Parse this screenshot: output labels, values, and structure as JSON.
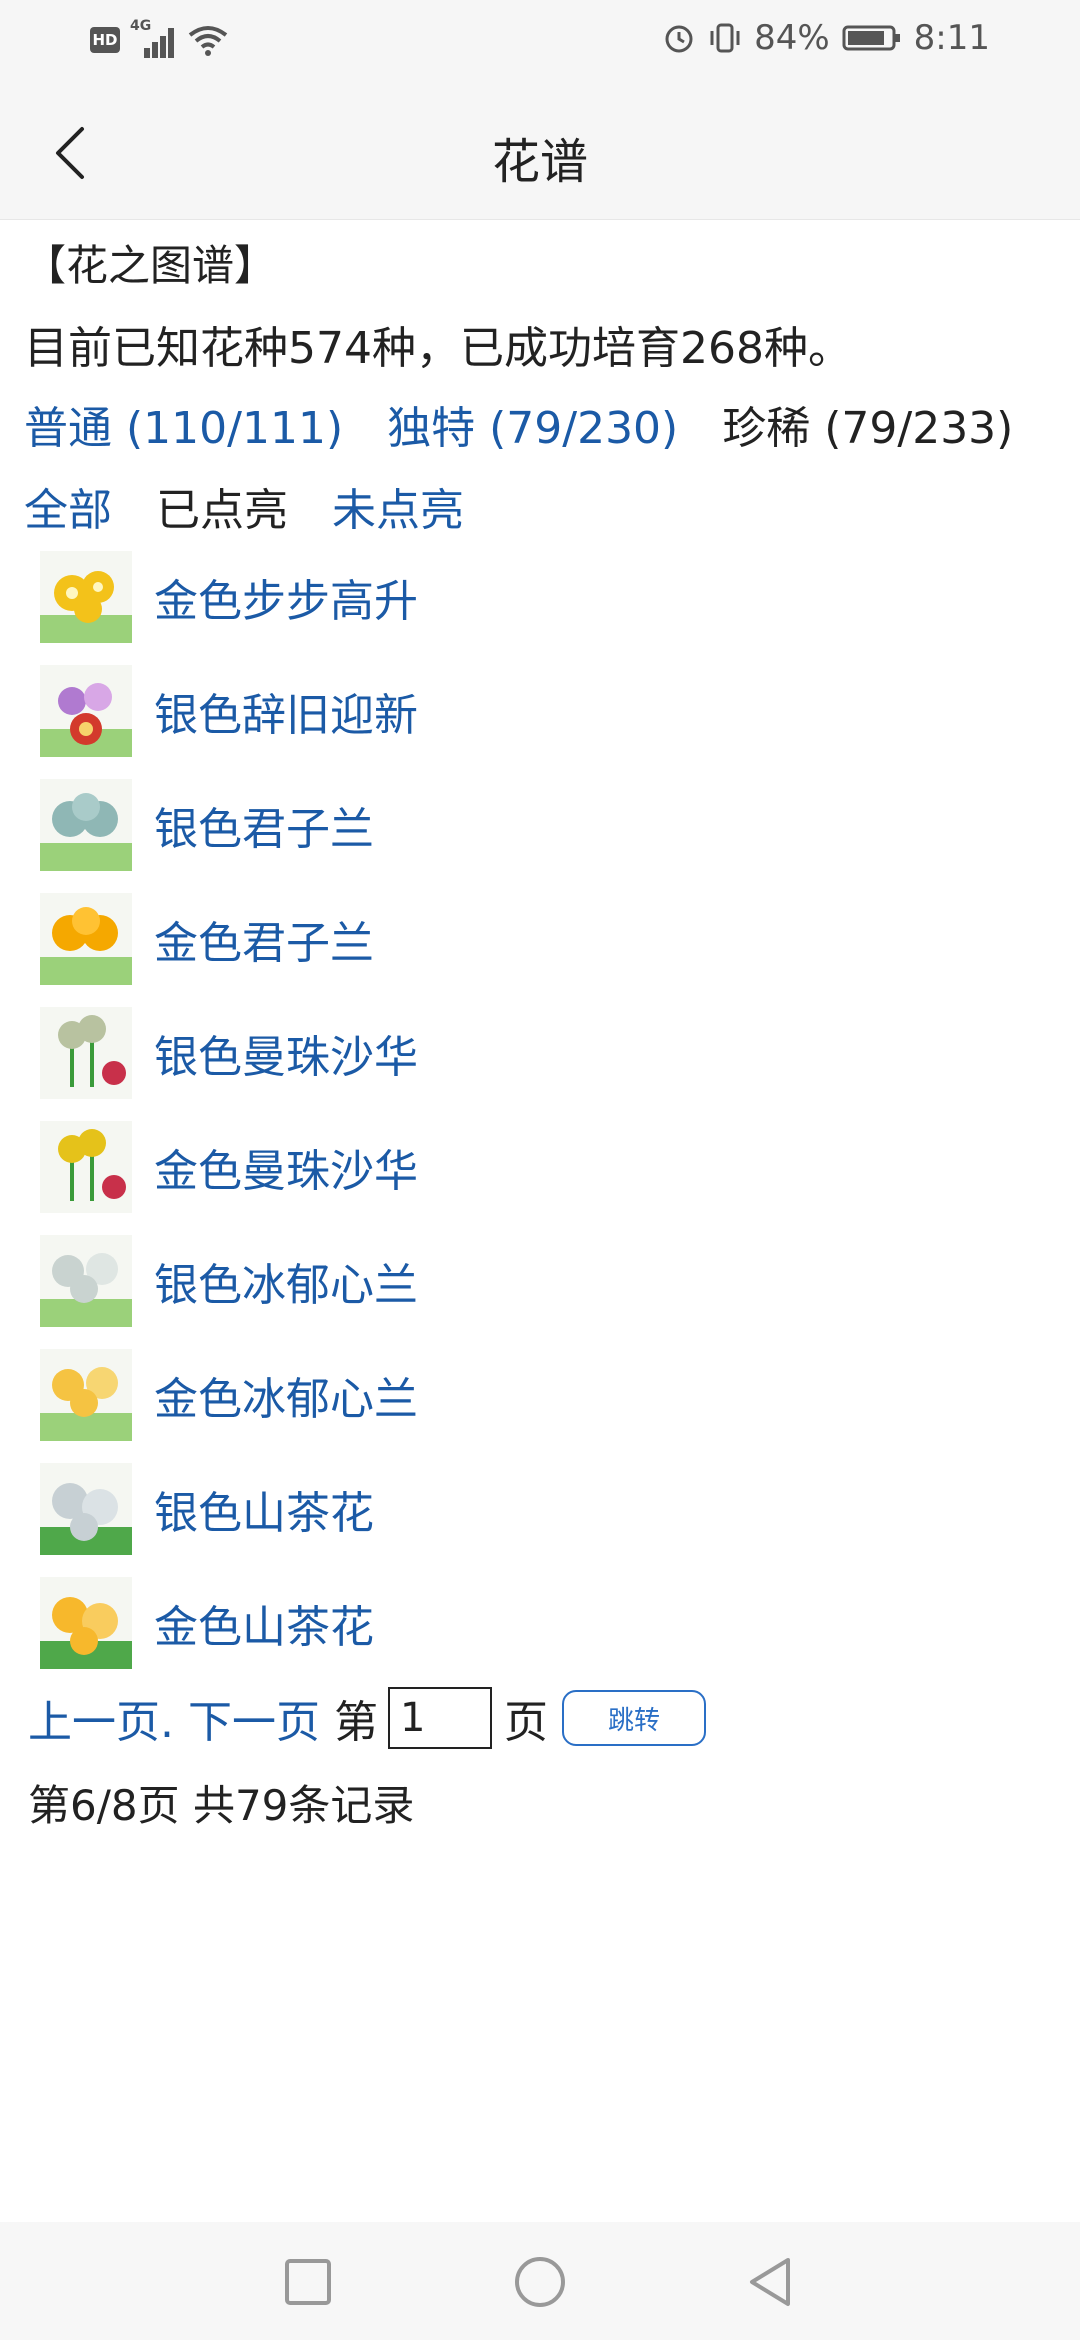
{
  "status_bar": {
    "hd": "HD",
    "network": "4G",
    "battery_percent": "84%",
    "time": "8:11"
  },
  "header": {
    "title": "花谱",
    "back_icon": "chevron-left-icon"
  },
  "section_title": "【花之图谱】",
  "summary": "目前已知花种574种，已成功培育268种。",
  "rarity_tabs": [
    {
      "label": "普通 (110/111)",
      "link": true
    },
    {
      "label": "独特 (79/230)",
      "link": true
    },
    {
      "label": "珍稀 (79/233)",
      "link": false
    }
  ],
  "filters": [
    {
      "label": "全部",
      "link": true
    },
    {
      "label": "已点亮",
      "link": false
    },
    {
      "label": "未点亮",
      "link": true
    }
  ],
  "flowers": [
    {
      "name": "金色步步高升",
      "icon": "flower-icon",
      "color": "#f3c21a"
    },
    {
      "name": "银色辞旧迎新",
      "icon": "flower-icon",
      "color": "#b07ad0"
    },
    {
      "name": "银色君子兰",
      "icon": "flower-icon",
      "color": "#8fb7b5"
    },
    {
      "name": "金色君子兰",
      "icon": "flower-icon",
      "color": "#f5a800"
    },
    {
      "name": "银色曼珠沙华",
      "icon": "flower-icon",
      "color": "#b8c2a0"
    },
    {
      "name": "金色曼珠沙华",
      "icon": "flower-icon",
      "color": "#e5c21a"
    },
    {
      "name": "银色冰郁心兰",
      "icon": "flower-icon",
      "color": "#c9d3d0"
    },
    {
      "name": "金色冰郁心兰",
      "icon": "flower-icon",
      "color": "#f5c342"
    },
    {
      "name": "银色山茶花",
      "icon": "flower-icon",
      "color": "#c7d0d4"
    },
    {
      "name": "金色山茶花",
      "icon": "flower-icon",
      "color": "#f7b82c"
    }
  ],
  "pager": {
    "prev": "上一页.",
    "next": "下一页",
    "page_label_pre": "第",
    "page_input_value": "1",
    "page_label_post": "页",
    "jump_button": "跳转"
  },
  "page_info": "第6/8页 共79条记录",
  "colors": {
    "link": "#1b5aa6",
    "text": "#222222",
    "button_border": "#2a6fc6"
  }
}
